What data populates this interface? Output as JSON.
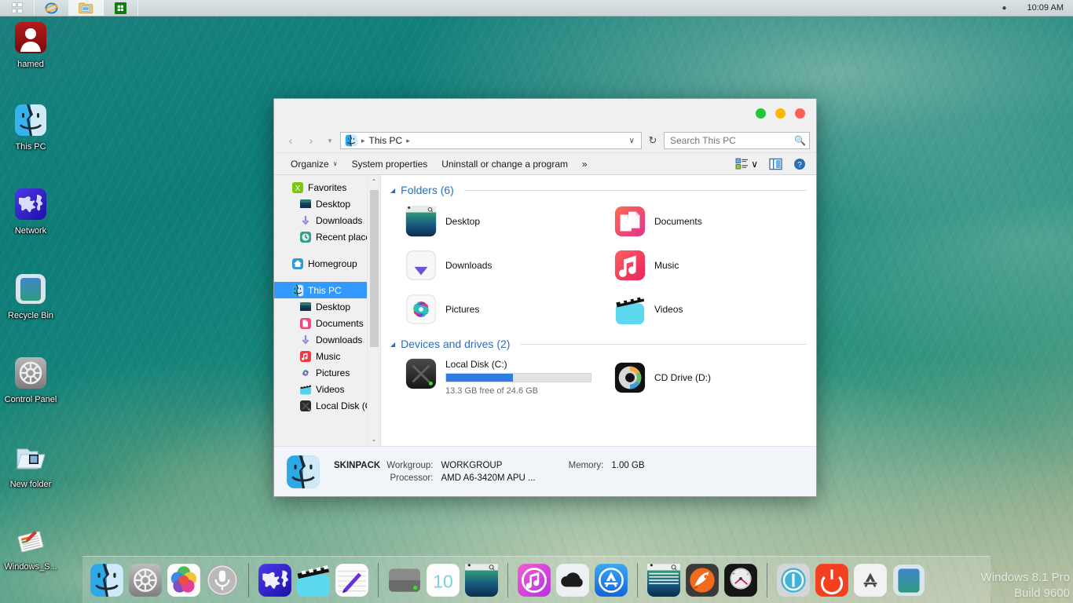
{
  "taskbar": {
    "buttons": [
      {
        "name": "start-button",
        "icon": "windows-logo-icon"
      },
      {
        "name": "internet-explorer-button",
        "icon": "internet-explorer-icon"
      },
      {
        "name": "file-explorer-button",
        "icon": "folder-icon"
      },
      {
        "name": "store-button",
        "icon": "windows-store-icon"
      }
    ],
    "tray_dot": "●",
    "clock": "10:09 AM"
  },
  "desktop": {
    "icons": [
      {
        "label": "hamed",
        "icon": "user-account-icon"
      },
      {
        "label": "This PC",
        "icon": "finder-icon"
      },
      {
        "label": "Network",
        "icon": "globe-network-icon"
      },
      {
        "label": "Recycle Bin",
        "icon": "recycle-bin-icon"
      },
      {
        "label": "Control Panel",
        "icon": "gear-settings-icon"
      },
      {
        "label": "New folder",
        "icon": "open-folder-icon"
      },
      {
        "label": "Windows_S...",
        "icon": "notepad-document-icon"
      }
    ]
  },
  "explorer": {
    "window_controls": {
      "close_label": "",
      "minimize_label": "",
      "zoom_label": "",
      "green": "#22c43a",
      "yellow": "#ffb700",
      "red": "#ff5f52"
    },
    "nav": {
      "back_glyph": "‹",
      "forward_glyph": "›",
      "recent_glyph": "▼",
      "refresh_glyph": "↻",
      "dropdown_glyph": "∨"
    },
    "breadcrumb": {
      "leading_sep": "▸",
      "path": "This PC",
      "trailing_sep": "▸"
    },
    "search": {
      "placeholder": "Search This PC",
      "value": "",
      "icon": "search-icon"
    },
    "commandbar": {
      "items": [
        {
          "label": "Organize",
          "caret": "∨",
          "name": "organize-menu"
        },
        {
          "label": "System properties",
          "caret": "",
          "name": "system-properties-button"
        },
        {
          "label": "Uninstall or change a program",
          "caret": "",
          "name": "uninstall-program-button"
        },
        {
          "label": "»",
          "caret": "",
          "name": "overflow-chevron-button"
        }
      ],
      "view_caret": "∨"
    },
    "navpane": {
      "groups": [
        {
          "header": {
            "label": "Favorites",
            "icon": "favorites-star-icon"
          },
          "children": [
            {
              "label": "Desktop",
              "icon": "desktop-icon"
            },
            {
              "label": "Downloads",
              "icon": "downloads-icon"
            },
            {
              "label": "Recent places",
              "icon": "recent-places-icon"
            }
          ]
        },
        {
          "header": {
            "label": "Homegroup",
            "icon": "homegroup-icon"
          },
          "children": []
        },
        {
          "header": {
            "label": "This PC",
            "icon": "finder-icon",
            "selected": true
          },
          "children": [
            {
              "label": "Desktop",
              "icon": "desktop-icon"
            },
            {
              "label": "Documents",
              "icon": "documents-icon"
            },
            {
              "label": "Downloads",
              "icon": "downloads-icon"
            },
            {
              "label": "Music",
              "icon": "music-icon"
            },
            {
              "label": "Pictures",
              "icon": "pictures-icon"
            },
            {
              "label": "Videos",
              "icon": "videos-icon"
            },
            {
              "label": "Local Disk (C:)",
              "icon": "local-disk-icon"
            }
          ]
        }
      ],
      "scroll_up": "⌃",
      "scroll_down": "⌄"
    },
    "content": {
      "folders_group": {
        "title": "Folders (6)",
        "collapse_glyph": "◢",
        "items": [
          {
            "label": "Desktop",
            "icon": "desktop-wallpaper-icon"
          },
          {
            "label": "Documents",
            "icon": "documents-icon"
          },
          {
            "label": "Downloads",
            "icon": "downloads-arrow-icon"
          },
          {
            "label": "Music",
            "icon": "music-note-icon"
          },
          {
            "label": "Pictures",
            "icon": "photos-pinwheel-icon"
          },
          {
            "label": "Videos",
            "icon": "videos-clapper-icon"
          }
        ]
      },
      "devices_group": {
        "title": "Devices and drives (2)",
        "collapse_glyph": "◢",
        "items": [
          {
            "label": "Local Disk (C:)",
            "icon": "hard-drive-icon",
            "free_text": "13.3 GB free of 24.6 GB",
            "used_percent": 46,
            "bar_color": "#2f7ce0"
          },
          {
            "label": "CD Drive (D:)",
            "icon": "cd-drive-icon"
          }
        ]
      }
    },
    "details": {
      "icon": "finder-icon",
      "computer_name": "SKINPACK",
      "rows": [
        {
          "key": "Workgroup:",
          "value": "WORKGROUP"
        },
        {
          "key": "Processor:",
          "value": "AMD A6-3420M APU ..."
        }
      ],
      "memory_key": "Memory:",
      "memory_value": "1.00 GB"
    }
  },
  "dock": {
    "items": [
      {
        "name": "finder",
        "icon": "finder-icon"
      },
      {
        "name": "system-preferences",
        "icon": "gear-settings-icon"
      },
      {
        "name": "color-picker",
        "icon": "color-balls-icon"
      },
      {
        "name": "siri",
        "icon": "microphone-icon"
      },
      {
        "name": "separator-1",
        "icon": "separator"
      },
      {
        "name": "safari",
        "icon": "globe-network-icon"
      },
      {
        "name": "quicktime",
        "icon": "videos-clapper-icon"
      },
      {
        "name": "notes",
        "icon": "notes-pen-icon"
      },
      {
        "name": "separator-2",
        "icon": "separator"
      },
      {
        "name": "hard-drive",
        "icon": "hard-drive-icon"
      },
      {
        "name": "os-x-version",
        "icon": "ten-icon",
        "text": "10"
      },
      {
        "name": "desktop",
        "icon": "desktop-wallpaper-icon"
      },
      {
        "name": "separator-3",
        "icon": "separator"
      },
      {
        "name": "itunes",
        "icon": "music-circle-icon"
      },
      {
        "name": "icloud",
        "icon": "cloud-icon"
      },
      {
        "name": "app-store",
        "icon": "app-store-icon"
      },
      {
        "name": "separator-4",
        "icon": "separator"
      },
      {
        "name": "finder-window",
        "icon": "finder-window-icon"
      },
      {
        "name": "launchpad",
        "icon": "rocket-icon"
      },
      {
        "name": "activity-monitor",
        "icon": "gauge-icon"
      },
      {
        "name": "separator-5",
        "icon": "separator"
      },
      {
        "name": "one-password",
        "icon": "onepassword-icon"
      },
      {
        "name": "shutdown",
        "icon": "power-icon"
      },
      {
        "name": "app-store-grey",
        "icon": "appstore-grey-icon"
      },
      {
        "name": "trash",
        "icon": "recycle-bin-icon"
      }
    ]
  },
  "watermark": {
    "line1": "Windows 8.1 Pro",
    "line2": "Build 9600"
  }
}
